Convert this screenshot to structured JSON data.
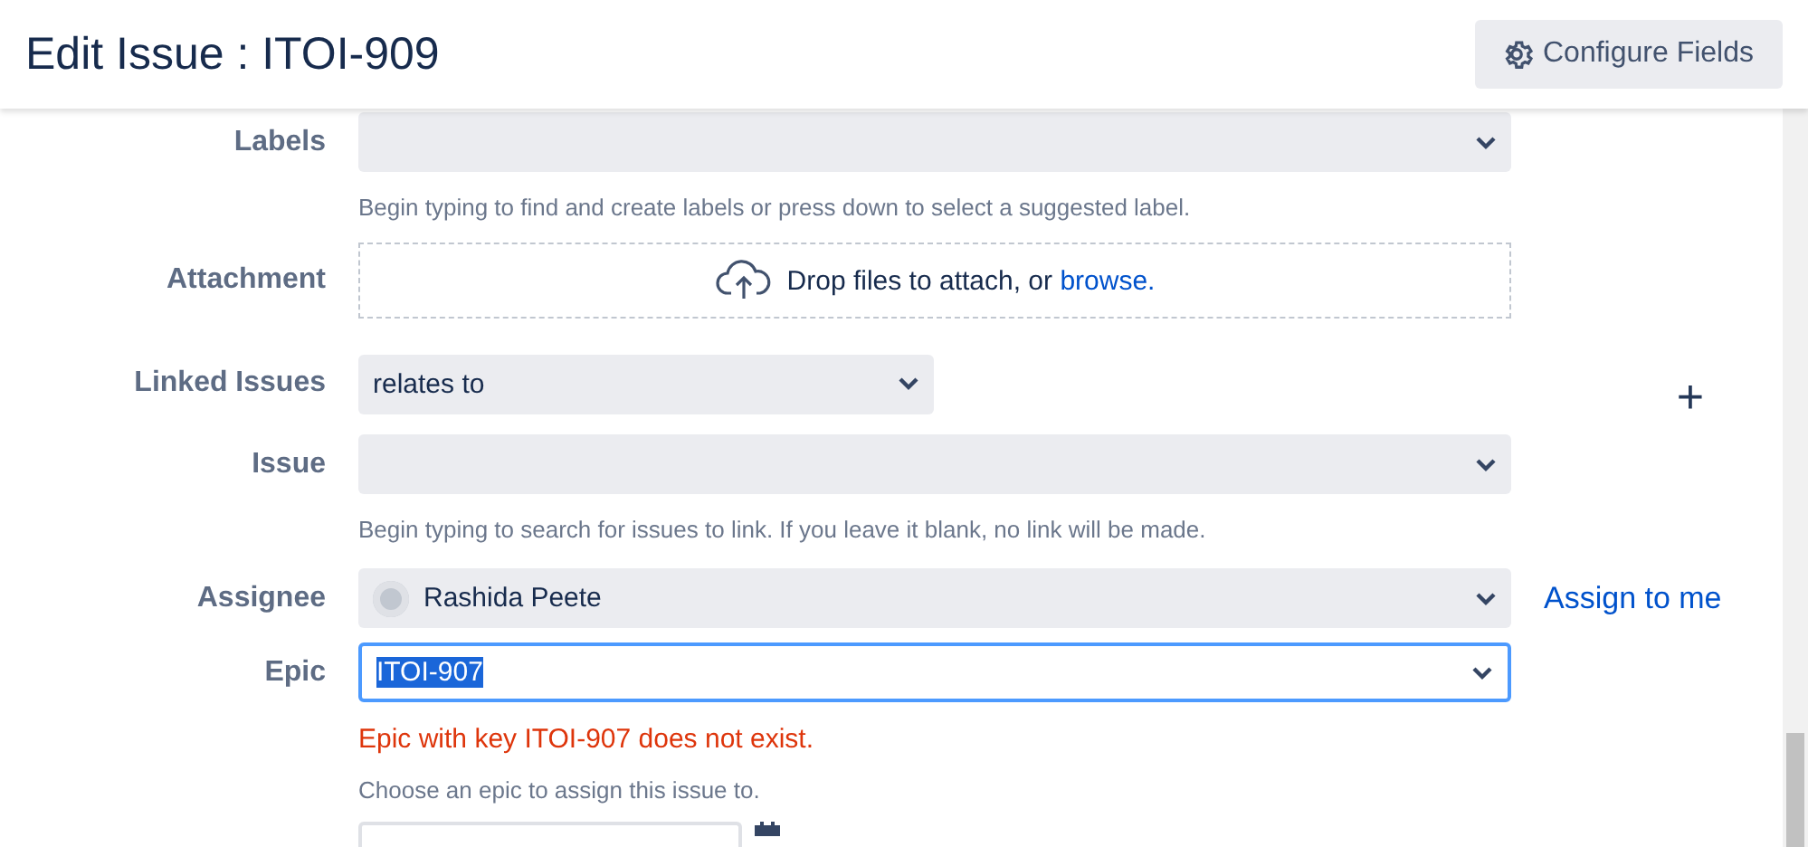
{
  "header": {
    "title": "Edit Issue : ITOI-909",
    "configure_button": "Configure Fields"
  },
  "fields": [
    {
      "kind": "select",
      "label": "Labels",
      "help": "Begin typing to find and create labels or press down to select a suggested label.",
      "focused": false
    },
    {
      "kind": "attachment",
      "label": "Attachment",
      "text": "Drop files to attach, or",
      "link": "browse."
    },
    {
      "kind": "linktype",
      "label": "Linked Issues",
      "value": "relates to",
      "add": "+"
    },
    {
      "kind": "select",
      "label": "Issue",
      "help": "Begin typing to search for issues to link. If you leave it blank, no link will be made.",
      "focused": false
    },
    {
      "kind": "user",
      "label": "Assignee",
      "value": "Rashida Peete",
      "action": "Assign to me"
    },
    {
      "kind": "select",
      "label": "Epic",
      "value": "ITOI-907",
      "value_selected": true,
      "error": "Epic with key ITOI-907 does not exist.",
      "help": "Choose an epic to assign this issue to.",
      "focused": true
    },
    {
      "kind": "date"
    }
  ]
}
